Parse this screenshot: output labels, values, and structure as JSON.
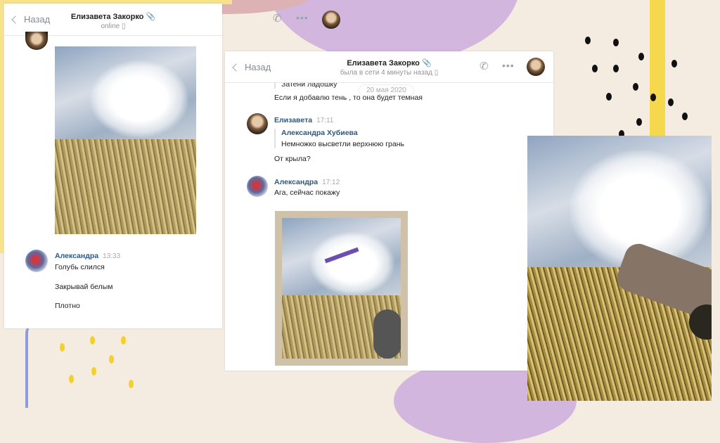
{
  "colors": {
    "accent": "#2a5885",
    "background": "#f4ebe1"
  },
  "chat1": {
    "back": "Назад",
    "title": "Елизавета Закорко",
    "status": "online",
    "message": {
      "author": "Александра",
      "time": "13:33",
      "lines": [
        "Голубь слился",
        "Закрывай белым",
        "Плотно"
      ]
    }
  },
  "chat2": {
    "back": "Назад",
    "title": "Елизавета Закорко",
    "status": "была в сети 4 минуты назад",
    "quote_tail": "Затени ладошку",
    "date": "20 мая 2020",
    "line1": "Если я добавлю тень , то она будет темная",
    "msg1": {
      "author": "Елизавета",
      "time": "17:11",
      "reply_author": "Александра Хубиева",
      "reply_text": "Немножко высветли верхнюю грань",
      "text": "От крыла?"
    },
    "msg2": {
      "author": "Александра",
      "time": "17:12",
      "text": "Ага, сейчас покажу"
    }
  },
  "icons": [
    "back-chevron-icon",
    "paperclip-icon",
    "phone-icon",
    "phone-device-icon",
    "more-icon"
  ]
}
